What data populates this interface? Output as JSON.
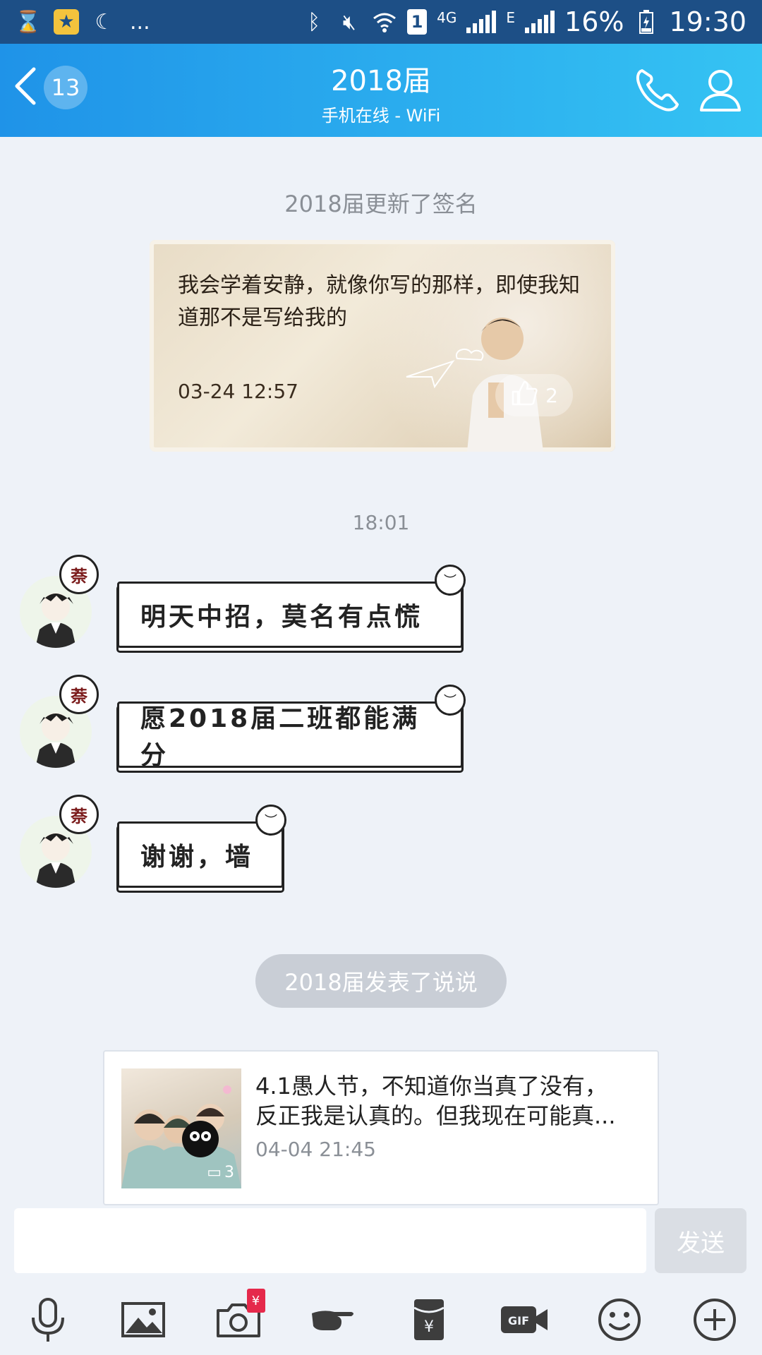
{
  "status_bar": {
    "network": "4G",
    "network2": "E",
    "sim": "1",
    "battery": "16%",
    "time": "19:30",
    "dots": "..."
  },
  "header": {
    "unread_count": "13",
    "title": "2018届",
    "subtitle": "手机在线 - WiFi"
  },
  "signature_update": {
    "notice": "2018届更新了签名",
    "text": "我会学着安静，就像你写的那样，即使我知道那不是写给我的",
    "time": "03-24 12:57",
    "likes": "2"
  },
  "time_divider": "18:01",
  "messages": [
    {
      "avatar_tag": "萘",
      "text": "明天中招，莫名有点慌"
    },
    {
      "avatar_tag": "萘",
      "text": "愿2018届二班都能满分"
    },
    {
      "avatar_tag": "萘",
      "text": "谢谢，墙"
    }
  ],
  "shuoshuo": {
    "notice": "2018届发表了说说",
    "line1": "4.1愚人节，不知道你当真了没有，",
    "line2": "反正我是认真的。但我现在可能真...",
    "time": "04-04 21:45",
    "photo_count": "3"
  },
  "composer": {
    "value": "",
    "send_label": "发送"
  },
  "toolbar": {
    "icons": [
      "mic-icon",
      "image-icon",
      "camera-icon",
      "poke-icon",
      "red-packet-icon",
      "gif-icon",
      "emoji-icon",
      "plus-icon"
    ],
    "red_packet_badge": "¥",
    "gif_label": "GIF"
  },
  "colors": {
    "header_start": "#1f93e8",
    "header_end": "#35c3f3",
    "status_bar": "#1d4f86",
    "background": "#eef2f8"
  }
}
